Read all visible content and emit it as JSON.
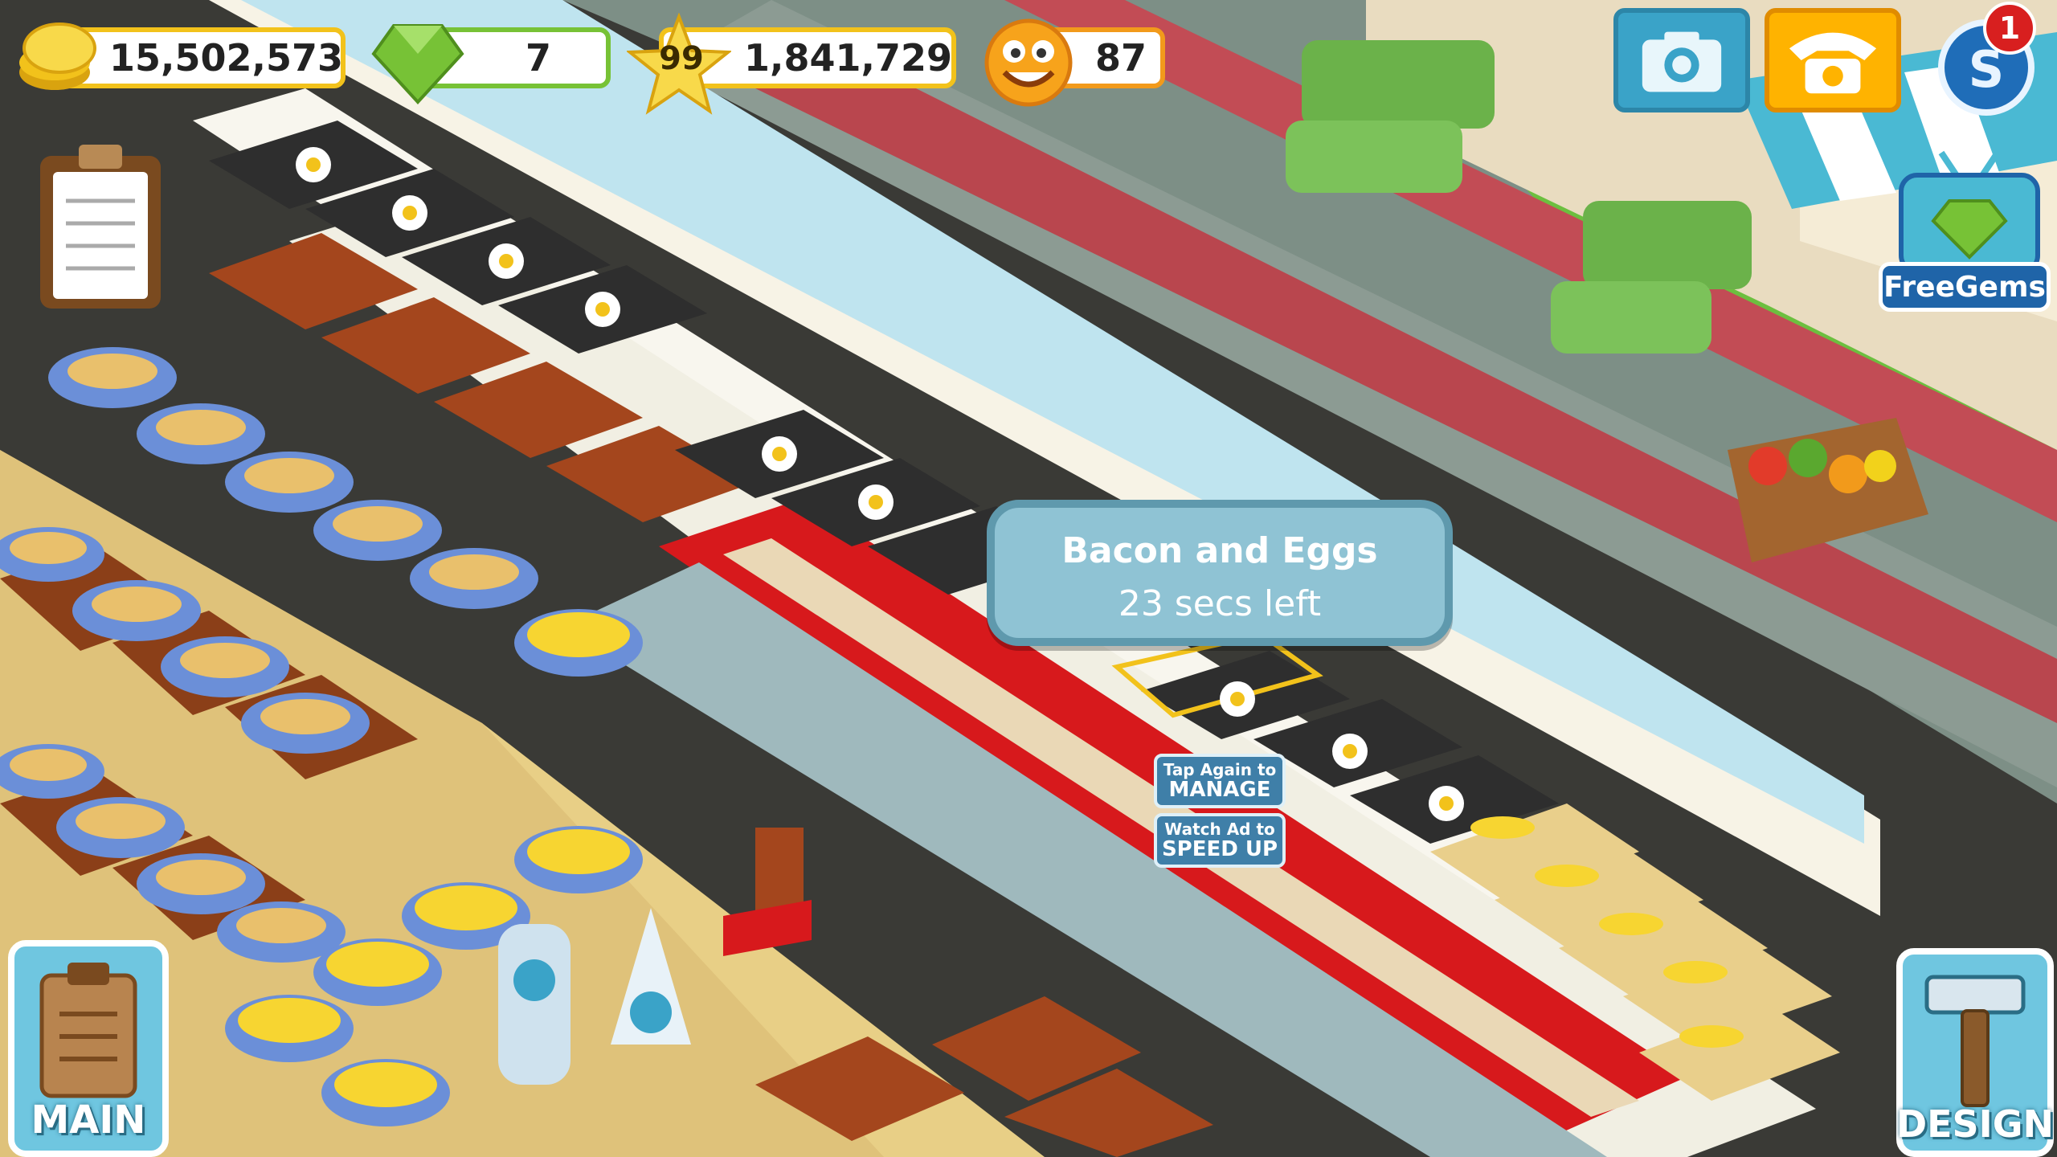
{
  "hud": {
    "coins": "15,502,573",
    "gems": "7",
    "level": "99",
    "stars": "1,841,729",
    "happiness": "87",
    "notifications": "1"
  },
  "buttons": {
    "free_gems": "FreeGems",
    "main": "MAIN",
    "design": "DESIGN"
  },
  "tooltip": {
    "dish": "Bacon and Eggs",
    "time_left": "23 secs left"
  },
  "context_menu": {
    "manage_line1": "Tap Again to",
    "manage_line2": "MANAGE",
    "speed_line1": "Watch Ad to",
    "speed_line2": "SPEED UP"
  },
  "colors": {
    "coin": "#f2c21b",
    "gem": "#77c236",
    "tooltip": "#8fc3d4",
    "button_blue": "#6fc6e0",
    "carpet_red": "#d7191c"
  },
  "icons": [
    "coin-icon",
    "gem-icon",
    "star-icon",
    "smiley-icon",
    "camera-icon",
    "phone-icon",
    "social-icon",
    "clipboard-icon",
    "hammer-icon"
  ]
}
